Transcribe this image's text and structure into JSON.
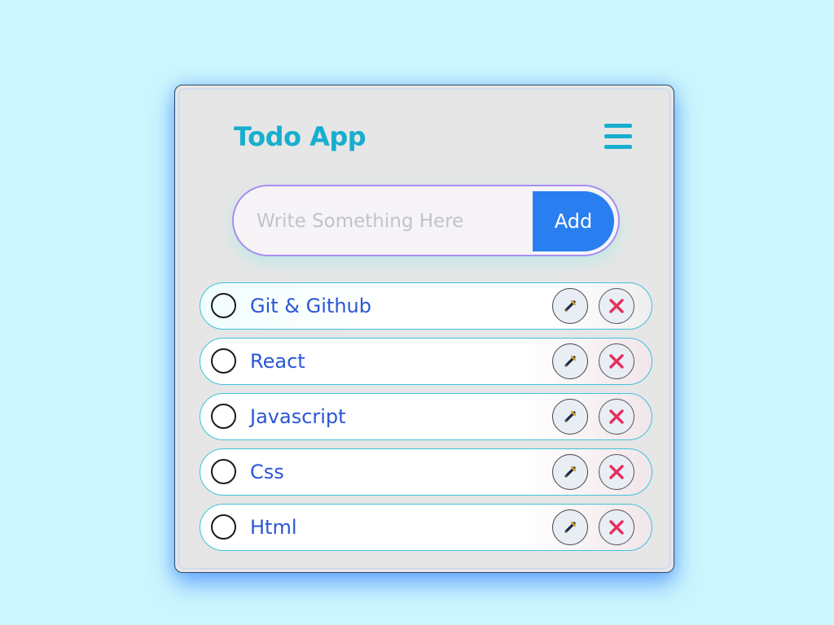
{
  "app": {
    "title": "Todo App"
  },
  "input": {
    "placeholder": "Write Something Here",
    "value": "",
    "add_label": "Add"
  },
  "todos": [
    {
      "text": "Git & Github",
      "done": false
    },
    {
      "text": "React",
      "done": false
    },
    {
      "text": "Javascript",
      "done": false
    },
    {
      "text": "Css",
      "done": false
    },
    {
      "text": "Html",
      "done": false
    }
  ],
  "icons": {
    "menu": "hamburger-menu-icon",
    "edit": "pen-icon",
    "delete": "close-x-icon"
  },
  "colors": {
    "background": "#ccf5fd",
    "accent": "#17aecf",
    "button": "#2a7ff0",
    "item_text": "#2a56d6",
    "delete": "#e62e5c"
  }
}
